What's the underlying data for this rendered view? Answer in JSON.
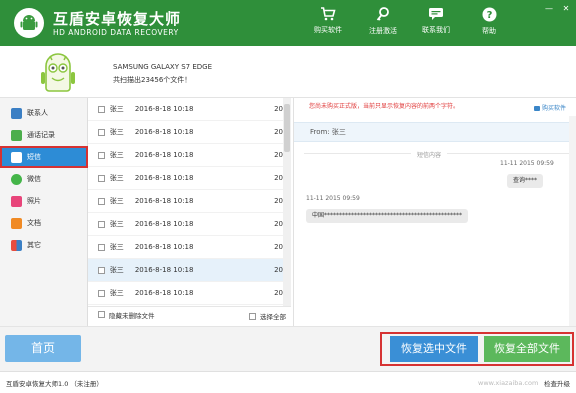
{
  "app": {
    "title": "互盾安卓恢复大师",
    "subtitle": "HD ANDROID DATA RECOVERY"
  },
  "nav": {
    "buy": "购买软件",
    "register": "注册激活",
    "contact": "联系我们",
    "help": "帮助"
  },
  "device": {
    "name": "SAMSUNG GALAXY S7 EDGE",
    "count": "共扫描出23456个文件！"
  },
  "sidebar": {
    "items": [
      {
        "label": "联系人",
        "icon": "contacts-icon"
      },
      {
        "label": "通话记录",
        "icon": "phone-icon"
      },
      {
        "label": "短信",
        "icon": "sms-icon"
      },
      {
        "label": "微信",
        "icon": "wechat-icon"
      },
      {
        "label": "照片",
        "icon": "photo-icon"
      },
      {
        "label": "文档",
        "icon": "document-icon"
      },
      {
        "label": "其它",
        "icon": "other-icon"
      }
    ],
    "active_index": 2
  },
  "messages": {
    "rows": [
      {
        "name": "张三",
        "date": "2016-8-18 10:18",
        "count": "20"
      },
      {
        "name": "张三",
        "date": "2016-8-18 10:18",
        "count": "20"
      },
      {
        "name": "张三",
        "date": "2016-8-18 10:18",
        "count": "20"
      },
      {
        "name": "张三",
        "date": "2016-8-18 10:18",
        "count": "20"
      },
      {
        "name": "张三",
        "date": "2016-8-18 10:18",
        "count": "20"
      },
      {
        "name": "张三",
        "date": "2016-8-18 10:18",
        "count": "20"
      },
      {
        "name": "张三",
        "date": "2016-8-18 10:18",
        "count": "20"
      },
      {
        "name": "张三",
        "date": "2016-8-18 10:18",
        "count": "20"
      },
      {
        "name": "张三",
        "date": "2016-8-18 10:18",
        "count": "20"
      }
    ],
    "hide_undeleted": "隐藏未删除文件",
    "select_all": "选择全部"
  },
  "detail": {
    "notice": "您尚未购买正式版，当前只显示恢复内容的前两个字符。",
    "buy_link": "购买软件",
    "from": "From: 张三",
    "divider": "短信内容",
    "msg1_time": "11-11  2015  09:59",
    "msg1_text": "查询****",
    "msg2_time": "11-11  2015  09:59",
    "msg2_text": "中国**********************************************"
  },
  "actions": {
    "home": "首页",
    "recover_selected": "恢复选中文件",
    "recover_all": "恢复全部文件"
  },
  "status": {
    "version": "互盾安卓恢复大师1.0  （未注册）",
    "watermark": "www.xiazaiba.com",
    "upgrade": "检查升级"
  },
  "colors": {
    "title_bg": "#2f8f3a",
    "accent_blue": "#3a8fd6",
    "accent_green": "#5cb85c",
    "highlight_red": "#d63232"
  }
}
